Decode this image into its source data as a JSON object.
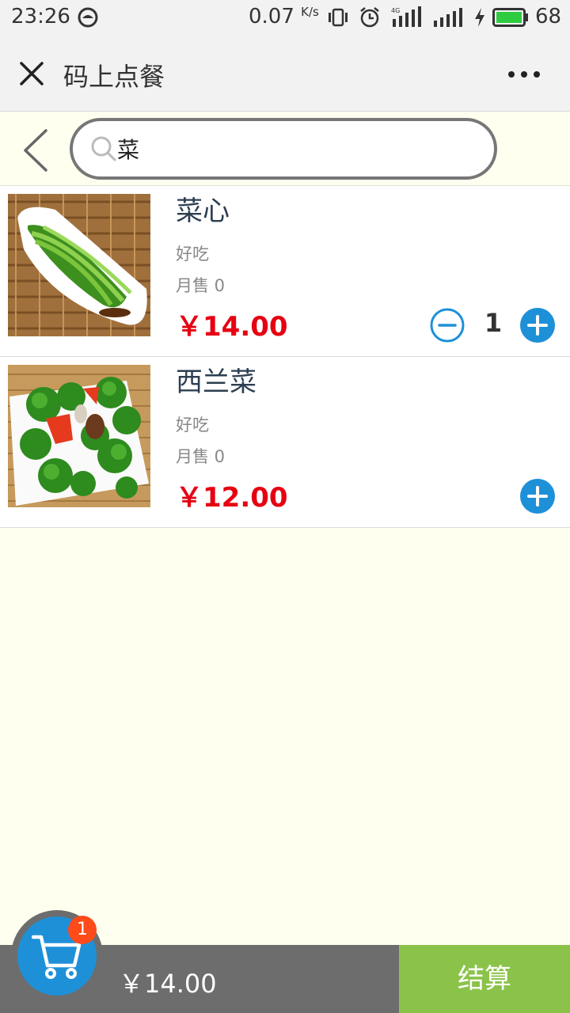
{
  "status_bar": {
    "time": "23:26",
    "speed_value": "0.07",
    "speed_unit": "K/s",
    "battery_level": "68"
  },
  "title_bar": {
    "title": "码上点餐"
  },
  "search": {
    "value": "菜"
  },
  "dishes": [
    {
      "name": "菜心",
      "description": "好吃",
      "sales": "月售 0",
      "price": "￥14.00",
      "quantity": "1",
      "photo": "choy-sum-photo"
    },
    {
      "name": "西兰菜",
      "description": "好吃",
      "sales": "月售 0",
      "price": "￥12.00",
      "photo": "broccoli-photo"
    }
  ],
  "cart": {
    "count": "1",
    "total": "￥14.00",
    "checkout_label": "结算"
  },
  "colors": {
    "accent": "#1e90d8",
    "price": "#e60012",
    "checkout": "#8bc34a",
    "badge": "#ff4a1a",
    "background": "#fffff0"
  }
}
